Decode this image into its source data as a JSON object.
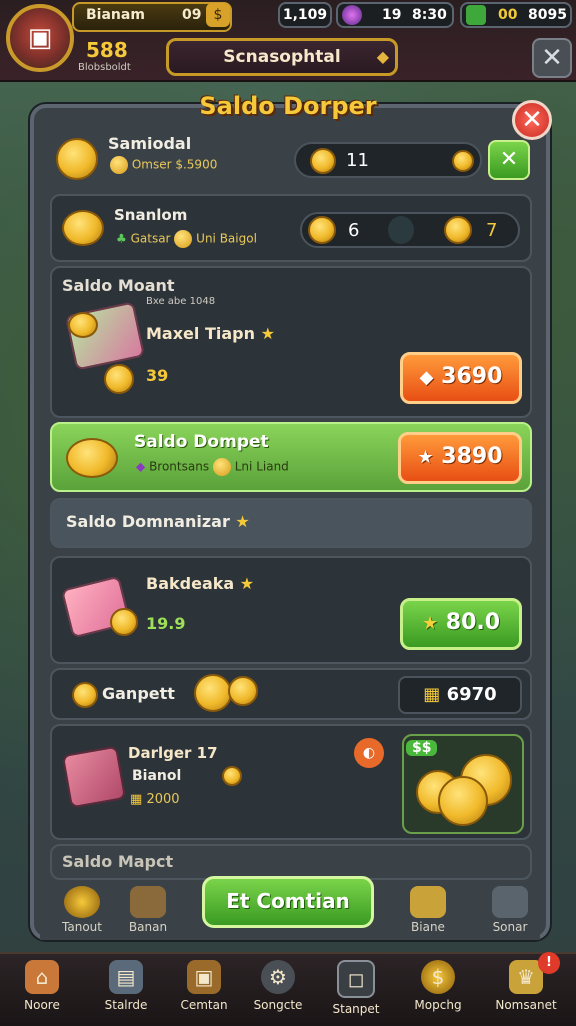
{
  "topbar": {
    "player_name": "Bianam",
    "level": "09",
    "gold": "588",
    "gold_sub": "Blobsboldt",
    "res1": "1,109",
    "res2_a": "19",
    "res2_b": "8:30",
    "res3_a": "00",
    "res3_b": "8095",
    "title_tag": "Scnasophtal",
    "close_glyph": "✕"
  },
  "panel": {
    "title": "Saldo Dorper",
    "close_glyph": "✕"
  },
  "rows": {
    "r1": {
      "title": "Samiodal",
      "sub": "Omser $.5900",
      "pill_value": "11"
    },
    "r2": {
      "title": "Snanlom",
      "sub_a": "Gatsar",
      "sub_b": "Uni Baigol",
      "left_val": "6",
      "right_val": "7"
    },
    "r3": {
      "header": "Saldo Moant",
      "sub_header": "Bxe abe 1048",
      "title": "Maxel Tiapn",
      "value": "39",
      "button": "3690"
    },
    "r4": {
      "title": "Saldo Dompet",
      "sub_a": "Brontsans",
      "sub_b": "Lni Liand",
      "button": "3890"
    },
    "r5": {
      "title": "Saldo Domnanizar"
    },
    "r6": {
      "title": "Bakdeaka",
      "value": "19.9",
      "button": "80.0"
    },
    "r7": {
      "title": "Ganpett",
      "value": "6970"
    },
    "r8": {
      "title": "Darlger 17",
      "sub": "Bianol",
      "value": "2000",
      "tag": "$$"
    },
    "r9": {
      "title": "Saldo Mapct"
    }
  },
  "tabs": [
    {
      "label": "Tanout"
    },
    {
      "label": "Banan"
    },
    {
      "label": "Biane"
    },
    {
      "label": "Sonar"
    }
  ],
  "main_cta": "Et Comtian",
  "bottom_nav": [
    {
      "label": "Noore"
    },
    {
      "label": "Stalrde"
    },
    {
      "label": "Cemtan"
    },
    {
      "label": "Songcte"
    },
    {
      "label": "Stanpet"
    },
    {
      "label": "Mopchg"
    },
    {
      "label": "Nomsanet"
    }
  ],
  "badge": "!"
}
